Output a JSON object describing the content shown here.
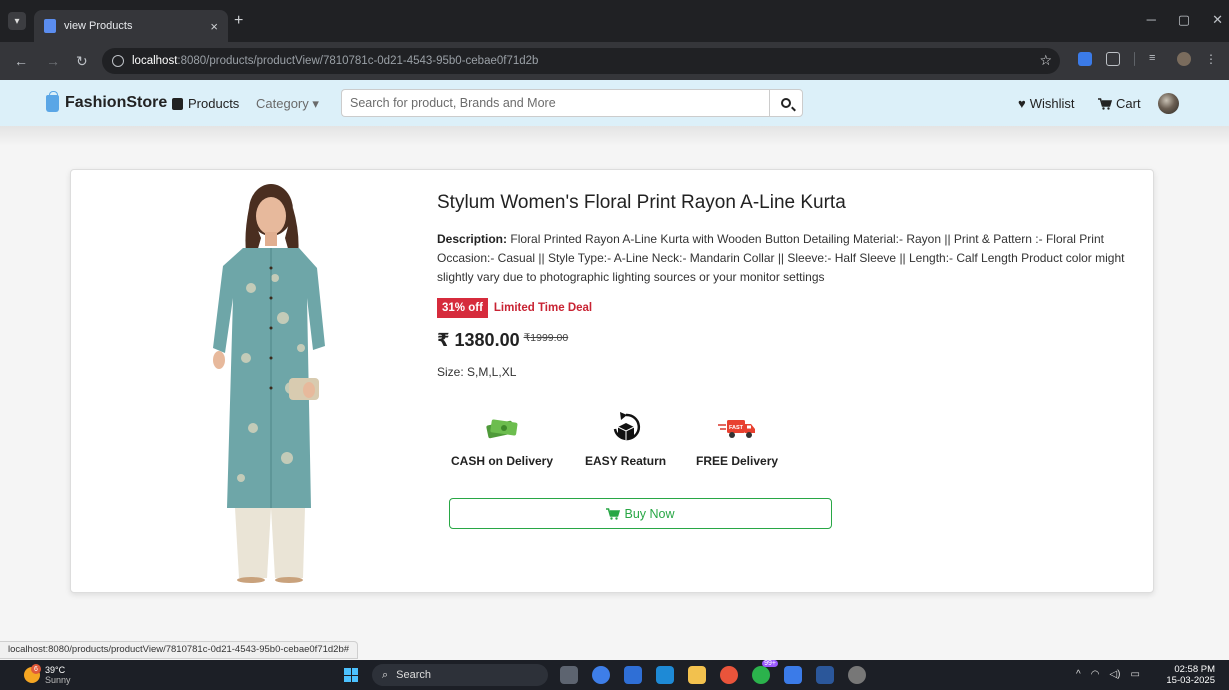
{
  "browser": {
    "tab_title": "view Products",
    "tab_close": "×",
    "new_tab": "+",
    "url_host": "localhost",
    "url_path": ":8080/products/productView/7810781c-0d21-4543-95b0-cebae0f71d2b"
  },
  "navbar": {
    "brand": "FashionStore",
    "products": "Products",
    "category": "Category ▾",
    "search_placeholder": "Search for product, Brands and More",
    "wishlist": "Wishlist",
    "cart": "Cart"
  },
  "product": {
    "title": "Stylum Women's Floral Print Rayon A-Line Kurta",
    "description_label": "Description:",
    "description": "Floral Printed Rayon A-Line Kurta with Wooden Button Detailing Material:- Rayon || Print & Pattern :- Floral Print Occasion:- Casual || Style Type:- A-Line Neck:- Mandarin Collar || Sleeve:- Half Sleeve || Length:- Calf Length Product color might slightly vary due to photographic lighting sources or your monitor settings",
    "discount": "31% off",
    "deal": "Limited Time Deal",
    "price": "₹ 1380.00",
    "mrp": "₹1999.00",
    "size": "Size: S,M,L,XL",
    "features": [
      "CASH on Delivery",
      "EASY Reaturn",
      "FREE Delivery"
    ],
    "buy_label": "Buy Now"
  },
  "statusbar": {
    "text": "localhost:8080/products/productView/7810781c-0d21-4543-95b0-cebae0f71d2b#"
  },
  "taskbar": {
    "weather_badge": "6",
    "temperature": "39°C",
    "condition": "Sunny",
    "search": "Search",
    "chrome_badge": "99+",
    "time": "02:58 PM",
    "date": "15-03-2025"
  },
  "colors": {
    "navbar_bg": "#dcf0f9",
    "discount_red": "#d62b3c",
    "buy_green": "#28a745",
    "kurta_teal": "#6ea6a8"
  }
}
